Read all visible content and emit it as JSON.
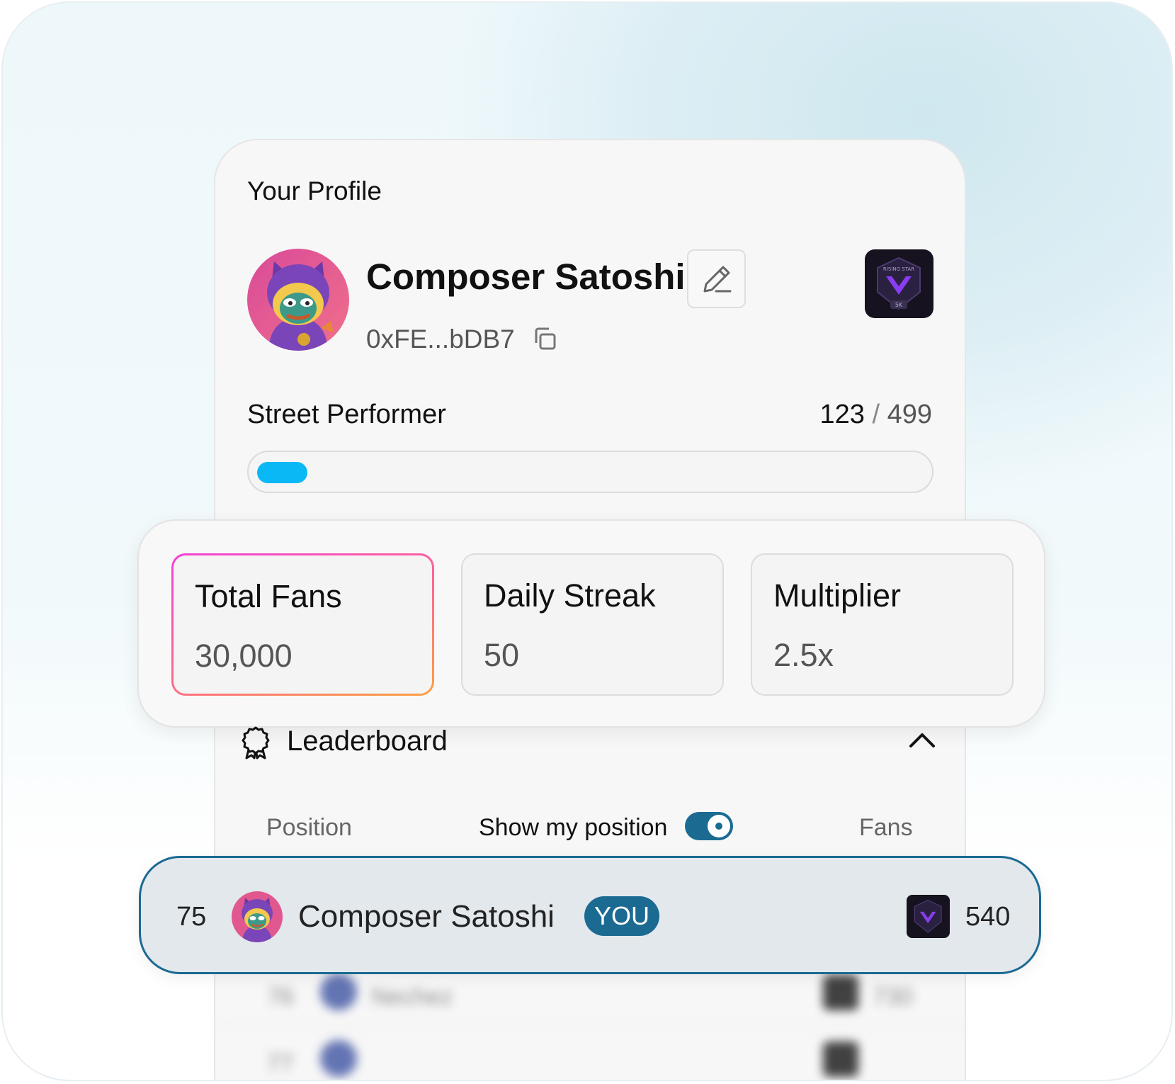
{
  "profile": {
    "section_title": "Your Profile",
    "name": "Composer Satoshi",
    "address": "0xFE...bDB7",
    "rank_badge": {
      "label": "RISING STAR",
      "tier": "5K"
    },
    "level": {
      "name": "Street Performer",
      "current": "123",
      "separator": "/",
      "max": "499",
      "progress_fraction": 0.075
    }
  },
  "stats": [
    {
      "label": "Total Fans",
      "value": "30,000",
      "active": true
    },
    {
      "label": "Daily Streak",
      "value": "50",
      "active": false
    },
    {
      "label": "Multiplier",
      "value": "2.5x",
      "active": false
    }
  ],
  "leaderboard": {
    "title": "Leaderboard",
    "columns": {
      "position": "Position",
      "show_my_position": "Show my position",
      "fans": "Fans"
    },
    "show_my_position_enabled": true,
    "my_row": {
      "rank": "75",
      "name": "Composer Satoshi",
      "tag": "YOU",
      "fans": "540"
    },
    "other_rows": [
      {
        "rank": "76",
        "name": "Nechez",
        "fans": "730"
      },
      {
        "rank": "77",
        "name": "",
        "fans": ""
      }
    ]
  },
  "colors": {
    "accent": "#1b6a92",
    "progress": "#0ab8f5",
    "active_gradient": [
      "#f43fd8",
      "#ffa040"
    ]
  },
  "icons": [
    "edit-icon",
    "copy-icon",
    "ribbon-award-icon",
    "chevron-up-icon"
  ]
}
